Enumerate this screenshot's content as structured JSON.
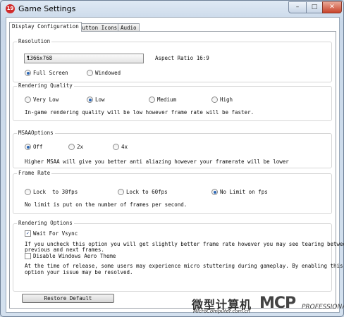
{
  "window": {
    "title": "Game Settings",
    "app_icon_glyph": "19",
    "controls": {
      "minimize": "–",
      "maximize": "□",
      "close": "✕"
    }
  },
  "tabs": [
    {
      "label": "Display Configuration"
    },
    {
      "label": "Button Icons"
    },
    {
      "label": "Audio"
    }
  ],
  "resolution": {
    "legend": "Resolution",
    "selected": "1366x768",
    "aspect": "Aspect Ratio 16:9",
    "modes": [
      {
        "label": "Full Screen",
        "checked": true
      },
      {
        "label": "Windowed",
        "checked": false
      }
    ]
  },
  "quality": {
    "legend": "Rendering Quality",
    "options": [
      {
        "label": "Very Low",
        "checked": false
      },
      {
        "label": "Low",
        "checked": true
      },
      {
        "label": "Medium",
        "checked": false
      },
      {
        "label": "High",
        "checked": false
      }
    ],
    "description": "In-game rendering quality will be low however frame rate will be faster."
  },
  "msaa": {
    "legend": "MSAAOptions",
    "options": [
      {
        "label": "Off",
        "checked": true
      },
      {
        "label": "2x",
        "checked": false
      },
      {
        "label": "4x",
        "checked": false
      }
    ],
    "description": "Higher MSAA will give you better anti aliazing however your framerate will be lower"
  },
  "framerate": {
    "legend": "Frame Rate",
    "options": [
      {
        "label": "Lock  to 30fps",
        "checked": false
      },
      {
        "label": "Lock to 60fps",
        "checked": false
      },
      {
        "label": "No Limit on fps",
        "checked": true
      }
    ],
    "description": "No limit is put on the number of frames per second."
  },
  "rendering_options": {
    "legend": "Rendering Options",
    "vsync": {
      "label": "Wait For Vsync",
      "checked": true,
      "desc1": "If you uncheck this option you will get slightly better frame rate however you may see tearing between",
      "desc2": "previous and next frames."
    },
    "aero": {
      "label": "Disable Windows Aero Theme",
      "checked": false,
      "desc1": "At the time of release, some users may experience micro stuttering during gameplay. By enabling this",
      "desc2": "option your issue may be resolved."
    }
  },
  "restore_label": "Restore Default",
  "watermark": {
    "cn": "微型计算机",
    "en": "MicroComputer.com.cn",
    "mcp": "MCP",
    "pro": "PROFESSIONAL"
  },
  "colors": {
    "radio_selected": "#2a66b4",
    "close_button": "#c9432a"
  },
  "icons": {
    "dropdown": "chevron-down-icon",
    "app": "app-icon",
    "check": "checkmark-icon"
  }
}
